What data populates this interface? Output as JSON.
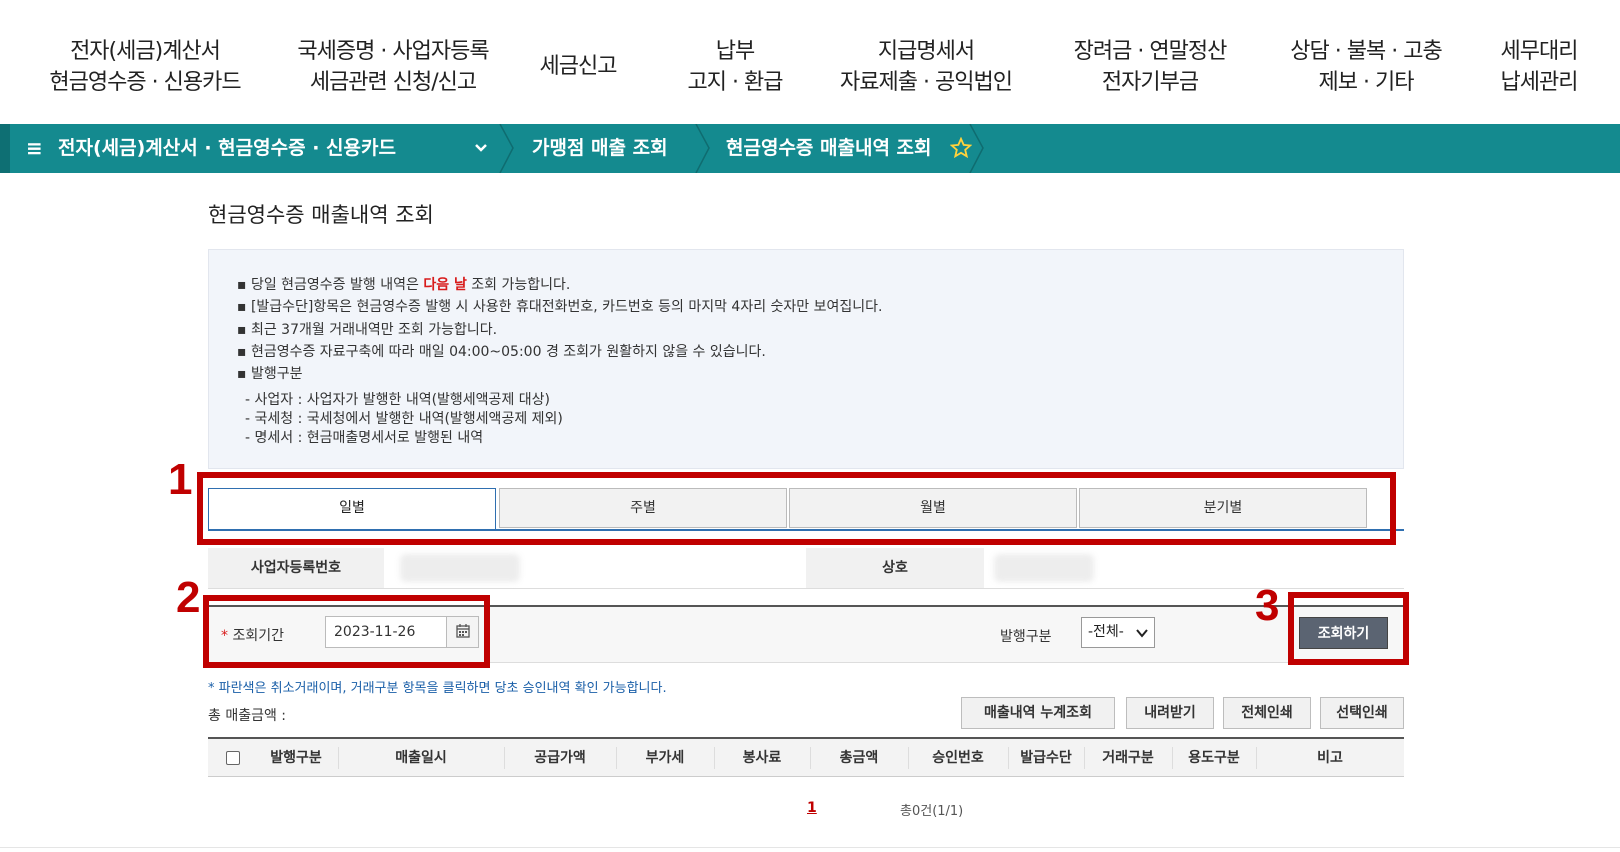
{
  "topnav": [
    {
      "line1": "전자(세금)계산서",
      "line2": "현금영수증 · 신용카드"
    },
    {
      "line1": "국세증명 · 사업자등록",
      "line2": "세금관련 신청/신고"
    },
    {
      "line1": "세금신고",
      "line2": ""
    },
    {
      "line1": "납부",
      "line2": "고지 · 환급"
    },
    {
      "line1": "지급명세서",
      "line2": "자료제출 · 공익법인"
    },
    {
      "line1": "장려금 · 연말정산",
      "line2": "전자기부금"
    },
    {
      "line1": "상담 · 불복 · 고충",
      "line2": "제보 · 기타"
    },
    {
      "line1": "세무대리",
      "line2": "납세관리"
    }
  ],
  "breadcrumb": {
    "menu_icon": "hamburger-icon",
    "level1": "전자(세금)계산서 · 현금영수증 · 신용카드",
    "level2": "가맹점 매출 조회",
    "level3": "현금영수증 매출내역 조회",
    "favorite_icon": "star-icon"
  },
  "page_title": "현금영수증 매출내역 조회",
  "notice": {
    "line1_pre": "당일 현금영수증 발행 내역은 ",
    "line1_highlight": "다음 날",
    "line1_post": " 조회 가능합니다.",
    "line2": "[발급수단]항목은 현금영수증 발행 시 사용한 휴대전화번호, 카드번호 등의 마지막 4자리 숫자만 보여집니다.",
    "line3": "최근 37개월 거래내역만 조회 가능합니다.",
    "line4": "현금영수증 자료구축에 따라 매일 04:00~05:00 경 조회가 원활하지 않을 수 있습니다.",
    "line5": "발행구분",
    "sub1": "- 사업자 : 사업자가 발행한 내역(발행세액공제 대상)",
    "sub2": "- 국세청 : 국세청에서 발행한 내역(발행세액공제 제외)",
    "sub3": "- 명세서 : 현금매출명세서로 발행된 내역"
  },
  "tabs": [
    "일별",
    "주별",
    "월별",
    "분기별"
  ],
  "active_tab": "일별",
  "info": {
    "bizno_label": "사업자등록번호",
    "name_label": "상호"
  },
  "search": {
    "period_label": "조회기간",
    "required_mark": "*",
    "date_value": "2023-11-26",
    "issue_type_label": "발행구분",
    "issue_type_value": "-전체-",
    "search_button": "조회하기"
  },
  "note": "* 파란색은 취소거래이며, 거래구분 항목을 클릭하면 당초 승인내역 확인 가능합니다.",
  "total_label": "총 매출금액 :",
  "buttons": {
    "cumulative": "매출내역 누계조회",
    "download": "내려받기",
    "print_all": "전체인쇄",
    "print_selected": "선택인쇄"
  },
  "table_headers": [
    "발행구분",
    "매출일시",
    "공급가액",
    "부가세",
    "봉사료",
    "총금액",
    "승인번호",
    "발급수단",
    "거래구분",
    "용도구분",
    "비고"
  ],
  "pagination": {
    "current_page": "1",
    "count_text": "총0건(1/1)"
  },
  "annotations": [
    "1",
    "2",
    "3"
  ],
  "colors": {
    "teal_bar": "#148a8f",
    "annotation_red": "#c00000",
    "tab_blue": "#2f6fb0"
  }
}
